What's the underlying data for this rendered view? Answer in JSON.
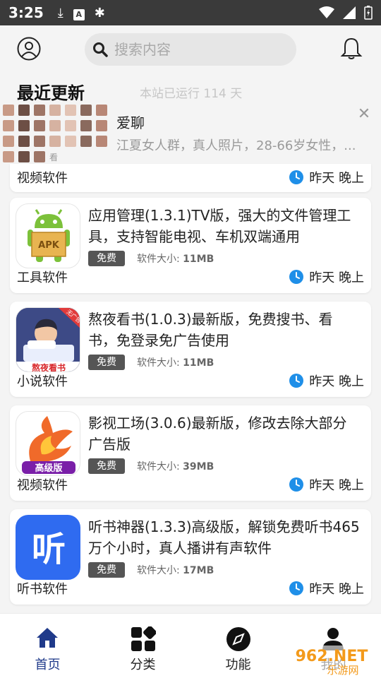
{
  "status_bar": {
    "time": "3:25",
    "colors": {
      "bg": "#3a3a3a"
    }
  },
  "search": {
    "placeholder": "搜索内容"
  },
  "section": {
    "title": "最近更新",
    "uptime": "本站已运行 114 天"
  },
  "ad": {
    "title": "爱聊",
    "desc": "江夏女人群，真人照片，28-66岁女性，...",
    "grid_caption": "看"
  },
  "partial_card": {
    "category": "视频软件",
    "time": "昨天 晚上"
  },
  "cards": [
    {
      "title": "应用管理(1.3.1)TV版，强大的文件管理工具，支持智能电视、车机双端通用",
      "badge": "免费",
      "size_label": "软件大小:",
      "size_value": "11MB",
      "category": "工具软件",
      "time": "昨天 晚上",
      "icon": "apk-android-icon",
      "icon_text": "APK"
    },
    {
      "title": "熬夜看书(1.0.3)最新版，免费搜书、看书，免登录免广告使用",
      "badge": "免费",
      "size_label": "软件大小:",
      "size_value": "11MB",
      "category": "小说软件",
      "time": "昨天 晚上",
      "icon": "reading-app-icon",
      "icon_text": "熬夜看书",
      "icon_ribbon": "无广告"
    },
    {
      "title": "影视工场(3.0.6)最新版，修改去除大部分广告版",
      "badge": "免费",
      "size_label": "软件大小:",
      "size_value": "39MB",
      "category": "视频软件",
      "time": "昨天 晚上",
      "icon": "phoenix-icon",
      "icon_text": "高级版"
    },
    {
      "title": "听书神器(1.3.3)高级版，解锁免费听书465万个小时，真人播讲有声软件",
      "badge": "免费",
      "size_label": "软件大小:",
      "size_value": "17MB",
      "category": "听书软件",
      "time": "昨天 晚上",
      "icon": "listen-icon",
      "icon_text": "听"
    }
  ],
  "nav": [
    {
      "label": "首页",
      "icon": "home-icon",
      "active": true
    },
    {
      "label": "分类",
      "icon": "category-grid-icon",
      "active": false
    },
    {
      "label": "功能",
      "icon": "compass-icon",
      "active": false
    },
    {
      "label": "我的",
      "icon": "user-icon",
      "active": false
    }
  ],
  "watermark": {
    "text_top": "962.NET",
    "text_bottom": "乐游网"
  },
  "colors": {
    "accent": "#1f3a8a",
    "clock": "#1f8fe8",
    "badge_bg": "#555555",
    "page_bg": "#f4f4f4"
  }
}
